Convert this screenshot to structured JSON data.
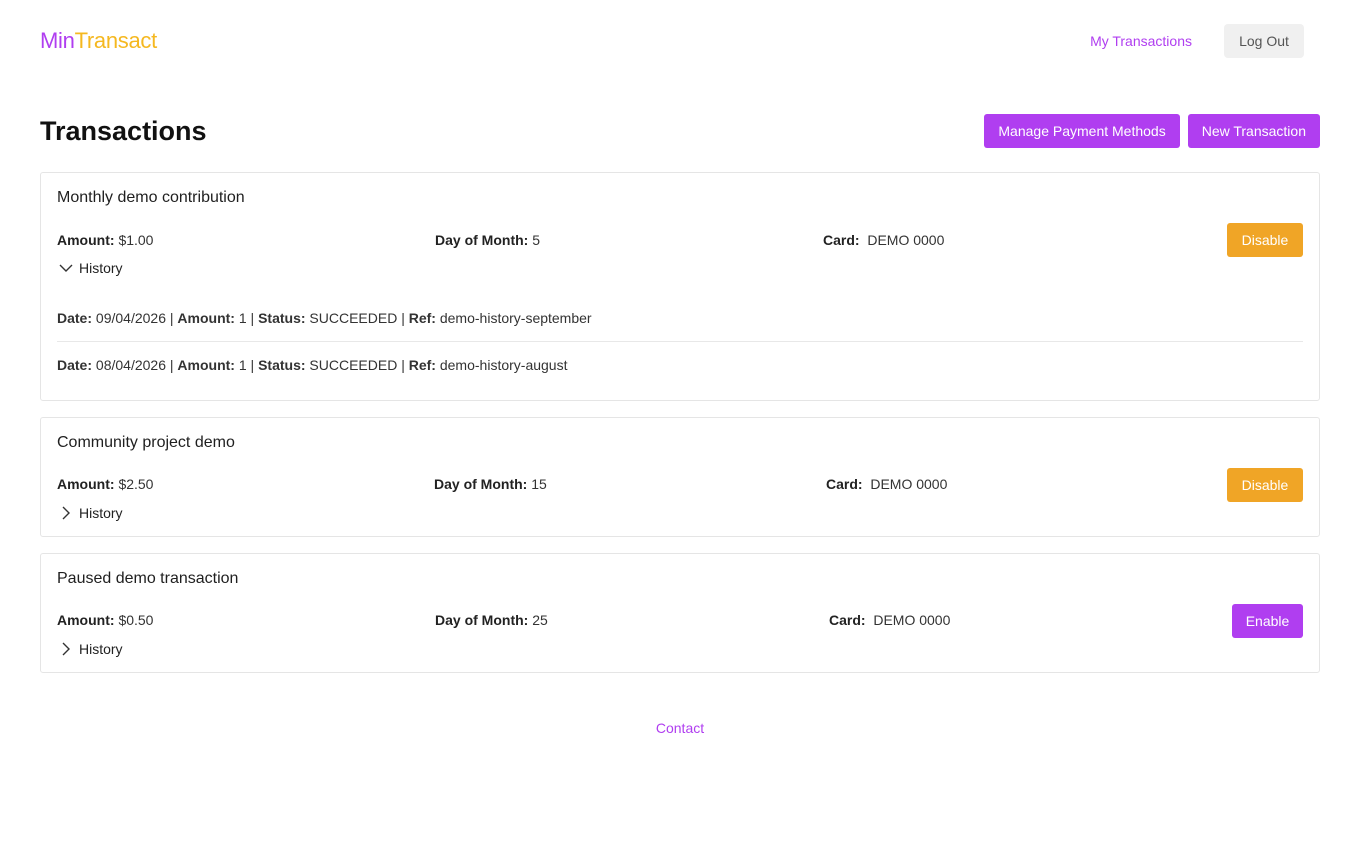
{
  "header": {
    "logo_part1": "Min",
    "logo_part2": "Transact",
    "nav_my_transactions": "My Transactions",
    "logout_label": "Log Out"
  },
  "page": {
    "title": "Transactions",
    "manage_payment_methods_label": "Manage Payment Methods",
    "new_transaction_label": "New Transaction"
  },
  "labels": {
    "amount": "Amount:",
    "day_of_month": "Day of Month:",
    "card": "Card:",
    "history": "History",
    "date": "Date:",
    "status": "Status:",
    "ref": "Ref:",
    "sep": " | "
  },
  "transactions": [
    {
      "title": "Monthly demo contribution",
      "amount": "$1.00",
      "day_of_month": "5",
      "card": "DEMO 0000",
      "action_label": "Disable",
      "history_expanded": true,
      "history": [
        {
          "date": "09/04/2026",
          "amount": "1",
          "status": "SUCCEEDED",
          "ref": "demo-history-september"
        },
        {
          "date": "08/04/2026",
          "amount": "1",
          "status": "SUCCEEDED",
          "ref": "demo-history-august"
        }
      ]
    },
    {
      "title": "Community project demo",
      "amount": "$2.50",
      "day_of_month": "15",
      "card": "DEMO 0000",
      "action_label": "Disable",
      "history_expanded": false
    },
    {
      "title": "Paused demo transaction",
      "amount": "$0.50",
      "day_of_month": "25",
      "card": "DEMO 0000",
      "action_label": "Enable",
      "history_expanded": false
    }
  ],
  "footer": {
    "contact_label": "Contact"
  },
  "colors": {
    "accent": "#b03ef0",
    "logo_secondary": "#f5b820",
    "warning": "#f0a526"
  }
}
